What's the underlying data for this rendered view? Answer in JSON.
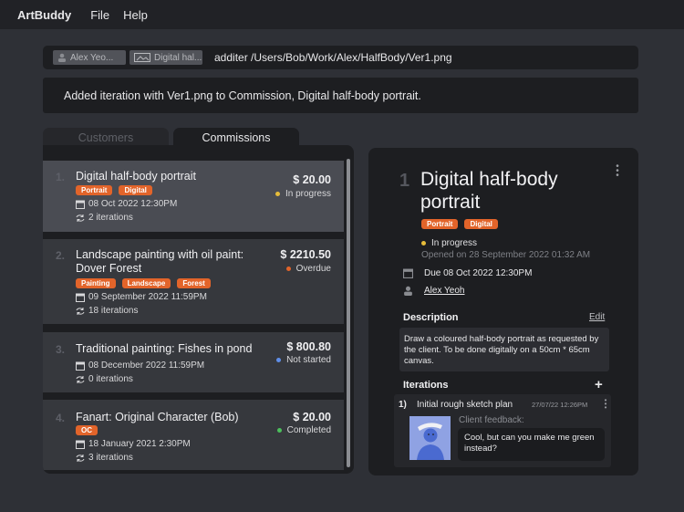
{
  "app": {
    "name": "ArtBuddy"
  },
  "menu": [
    {
      "label": "File"
    },
    {
      "label": "Help"
    }
  ],
  "command": {
    "chips": [
      {
        "label": "Alex Yeo...",
        "icon": "person-icon"
      },
      {
        "label": "Digital hal...",
        "icon": "image-icon"
      }
    ],
    "text": "additer /Users/Bob/Work/Alex/HalfBody/Ver1.png"
  },
  "result": {
    "text": "Added iteration with Ver1.png to Commission, Digital half-body portrait."
  },
  "tabs": [
    {
      "label": "Customers",
      "active": false
    },
    {
      "label": "Commissions",
      "active": true
    }
  ],
  "commissions": [
    {
      "index": "1.",
      "title": "Digital half-body portrait",
      "price": "$ 20.00",
      "status": "In progress",
      "status_color": "#e6bc3a",
      "tags": [
        "Portrait",
        "Digital"
      ],
      "date": "08 Oct 2022 12:30PM",
      "iterations": "2 iterations"
    },
    {
      "index": "2.",
      "title": "Landscape painting with oil paint: Dover Forest",
      "price": "$ 2210.50",
      "status": "Overdue",
      "status_color": "#e2642a",
      "tags": [
        "Painting",
        "Landscape",
        "Forest"
      ],
      "date": "09 September 2022 11:59PM",
      "iterations": "18 iterations"
    },
    {
      "index": "3.",
      "title": "Traditional painting: Fishes in pond",
      "price": "$ 800.80",
      "status": "Not started",
      "status_color": "#5f8ee8",
      "tags": [],
      "date": "08 December 2022 11:59PM",
      "iterations": "0 iterations"
    },
    {
      "index": "4.",
      "title": "Fanart: Original Character (Bob)",
      "price": "$ 20.00",
      "status": "Completed",
      "status_color": "#4cbf5c",
      "tags": [
        "OC"
      ],
      "date": "18 January 2021 2:30PM",
      "iterations": "3 iterations"
    }
  ],
  "detail": {
    "index": "1",
    "title": "Digital half-body portrait",
    "tags": [
      "Portrait",
      "Digital"
    ],
    "status": "In progress",
    "status_color": "#e6bc3a",
    "opened": "Opened on 28 September 2022 01:32 AM",
    "due": "Due 08 Oct 2022 12:30PM",
    "customer": "Alex Yeoh",
    "description_heading": "Description",
    "edit_label": "Edit",
    "description": "Draw a coloured half-body portrait as requested by the client. To be done digitally on a 50cm * 65cm canvas.",
    "iterations_heading": "Iterations",
    "iteration": {
      "index": "1)",
      "title": "Initial rough sketch plan",
      "date": "27/07/22 12:26PM",
      "feedback_label": "Client feedback:",
      "feedback": "Cool, but can you make me green instead?"
    }
  },
  "colors": {
    "accent": "#e2642a",
    "background": "#2e3036",
    "panel": "#1d1e21"
  }
}
